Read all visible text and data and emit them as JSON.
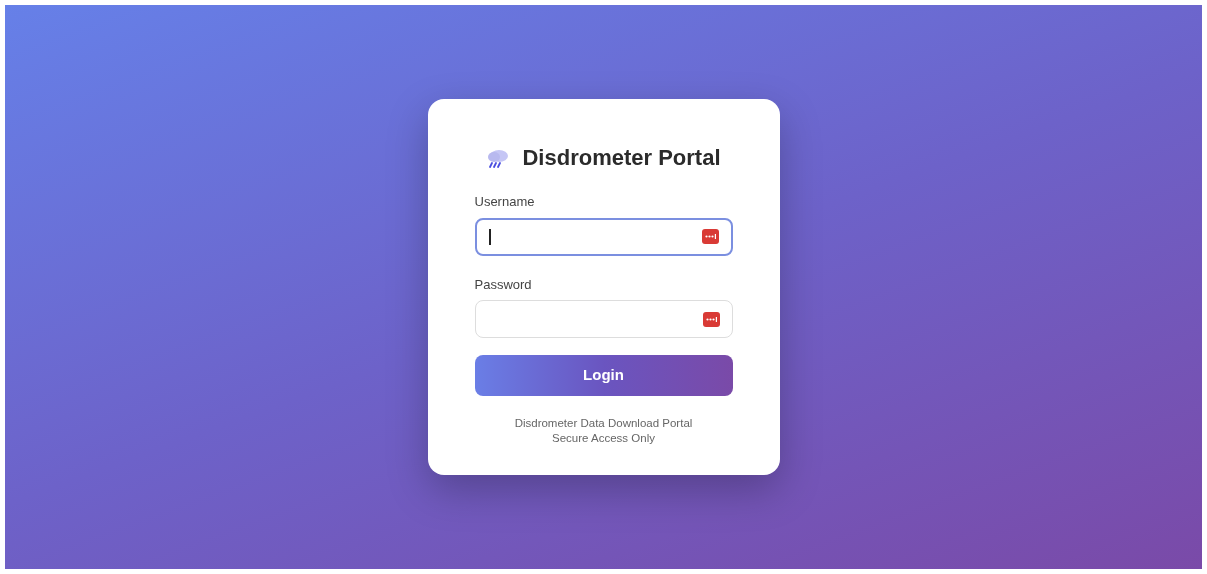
{
  "title": "Disdrometer Portal",
  "fields": [
    {
      "label": "Username",
      "focused": true
    },
    {
      "label": "Password",
      "focused": false
    }
  ],
  "login_button": "Login",
  "footer": [
    "Disdrometer Data Download Portal",
    "Secure Access Only"
  ]
}
